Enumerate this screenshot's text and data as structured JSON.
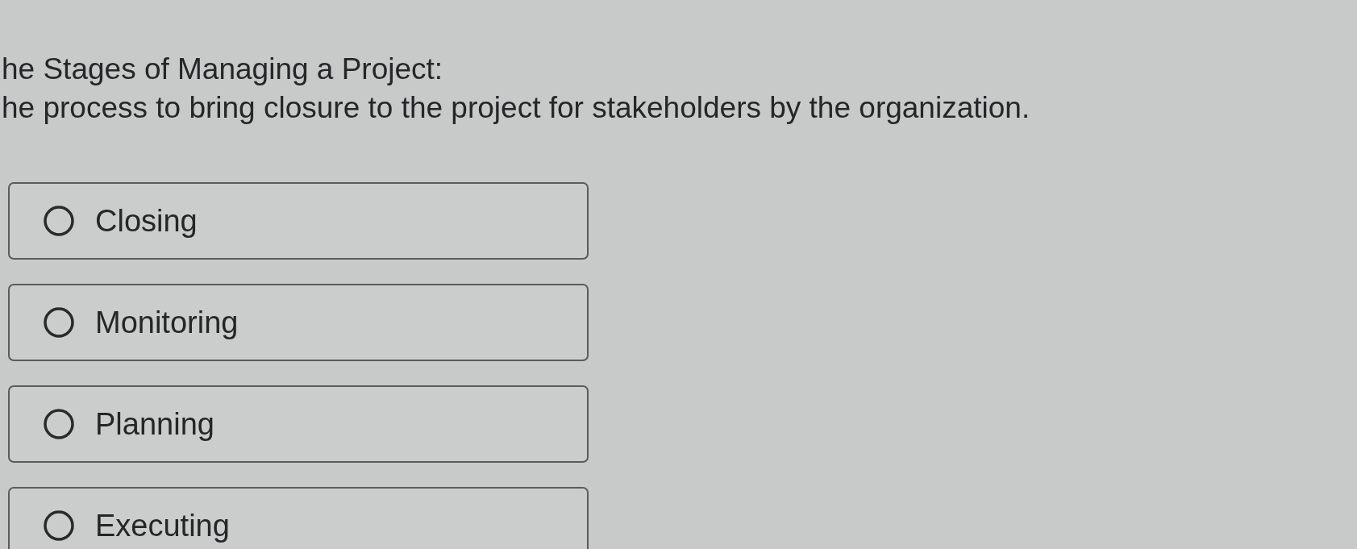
{
  "question": {
    "title": "he Stages of Managing a Project:",
    "prompt": "he process to bring closure to the project for stakeholders by the organization."
  },
  "options": [
    {
      "label": "Closing",
      "selected": false
    },
    {
      "label": "Monitoring",
      "selected": false
    },
    {
      "label": "Planning",
      "selected": false
    },
    {
      "label": "Executing",
      "selected": false
    }
  ]
}
